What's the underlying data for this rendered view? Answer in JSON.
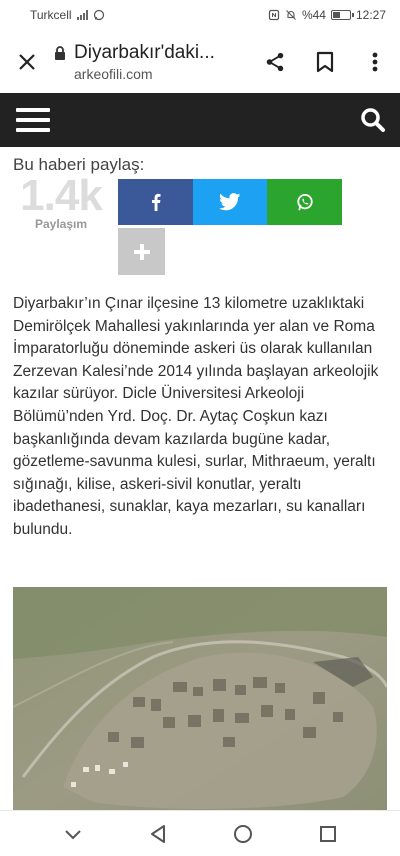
{
  "status_bar": {
    "carrier": "Turkcell",
    "battery_text": "%44",
    "time": "12:27",
    "battery_level": 0.44,
    "icons": [
      "signal-icon",
      "whatsapp-notification-icon",
      "nfc-icon",
      "mute-icon",
      "battery-icon"
    ]
  },
  "browser": {
    "page_title": "Diyarbakır'daki...",
    "domain": "arkeofili.com",
    "icons": [
      "close-icon",
      "lock-icon",
      "share-icon",
      "bookmark-icon",
      "more-vert-icon"
    ]
  },
  "site_nav": {
    "icons": [
      "menu-icon",
      "search-icon"
    ]
  },
  "share": {
    "heading": "Bu haberi paylaş:",
    "count": "1.4k",
    "count_label": "Paylaşım",
    "colors": {
      "facebook": "#3b5998",
      "twitter": "#1da1f2",
      "whatsapp": "#2ca52f",
      "more": "#c8c8c8"
    },
    "icons": [
      "facebook-icon",
      "twitter-icon",
      "whatsapp-icon",
      "plus-icon"
    ]
  },
  "article": {
    "paragraph": "Diyarbakır’ın Çınar ilçesine 13 kilometre uzaklıktaki Demirölçek Mahallesi yakınlarında yer alan ve Roma İmparatorluğu döneminde askeri üs olarak kullanılan Zerzevan Kalesi’nde 2014 yılında başlayan arkeolojik kazılar sürüyor. Dicle Üniversitesi Arkeoloji Bölümü’nden Yrd. Doç. Dr. Aytaç Coşkun kazı başkanlığında devam kazılarda bugüne kadar, gözetleme-savunma kulesi, surlar, Mithraeum, yeraltı sığınağı, kilise, askeri-sivil konutlar, yeraltı ibadethanesi, sunaklar, kaya mezarları, su kanalları bulundu."
  },
  "photo": {
    "subject": "aerial-view-of-ruins"
  },
  "system_nav": {
    "icons": [
      "chevron-down-icon",
      "back-icon",
      "home-icon",
      "recents-icon"
    ]
  }
}
